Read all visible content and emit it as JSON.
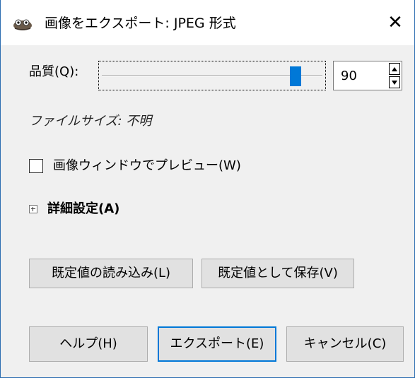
{
  "window": {
    "title": "画像をエクスポート: JPEG 形式",
    "close_glyph": "✕"
  },
  "quality": {
    "label": "品質(Q):",
    "value": "90",
    "min": 0,
    "max": 100,
    "slider_value": 90
  },
  "file_size": "ファイルサイズ: 不明",
  "preview": {
    "label": "画像ウィンドウでプレビュー(W)",
    "checked": false
  },
  "advanced": {
    "label": "詳細設定(A)",
    "expanded": false
  },
  "defaults_buttons": {
    "load_label": "既定値の読み込み(L)",
    "save_label": "既定値として保存(V)"
  },
  "action_buttons": {
    "help_label": "ヘルプ(H)",
    "export_label": "エクスポート(E)",
    "cancel_label": "キャンセル(C)"
  },
  "colors": {
    "accent": "#0078d7",
    "window_border": "#2b6cb0"
  },
  "icons": {
    "app": "gimp-icon",
    "close": "close-icon",
    "spin_up": "spin-up-arrow-icon",
    "spin_down": "spin-down-arrow-icon",
    "expander": "expander-plus-icon"
  }
}
